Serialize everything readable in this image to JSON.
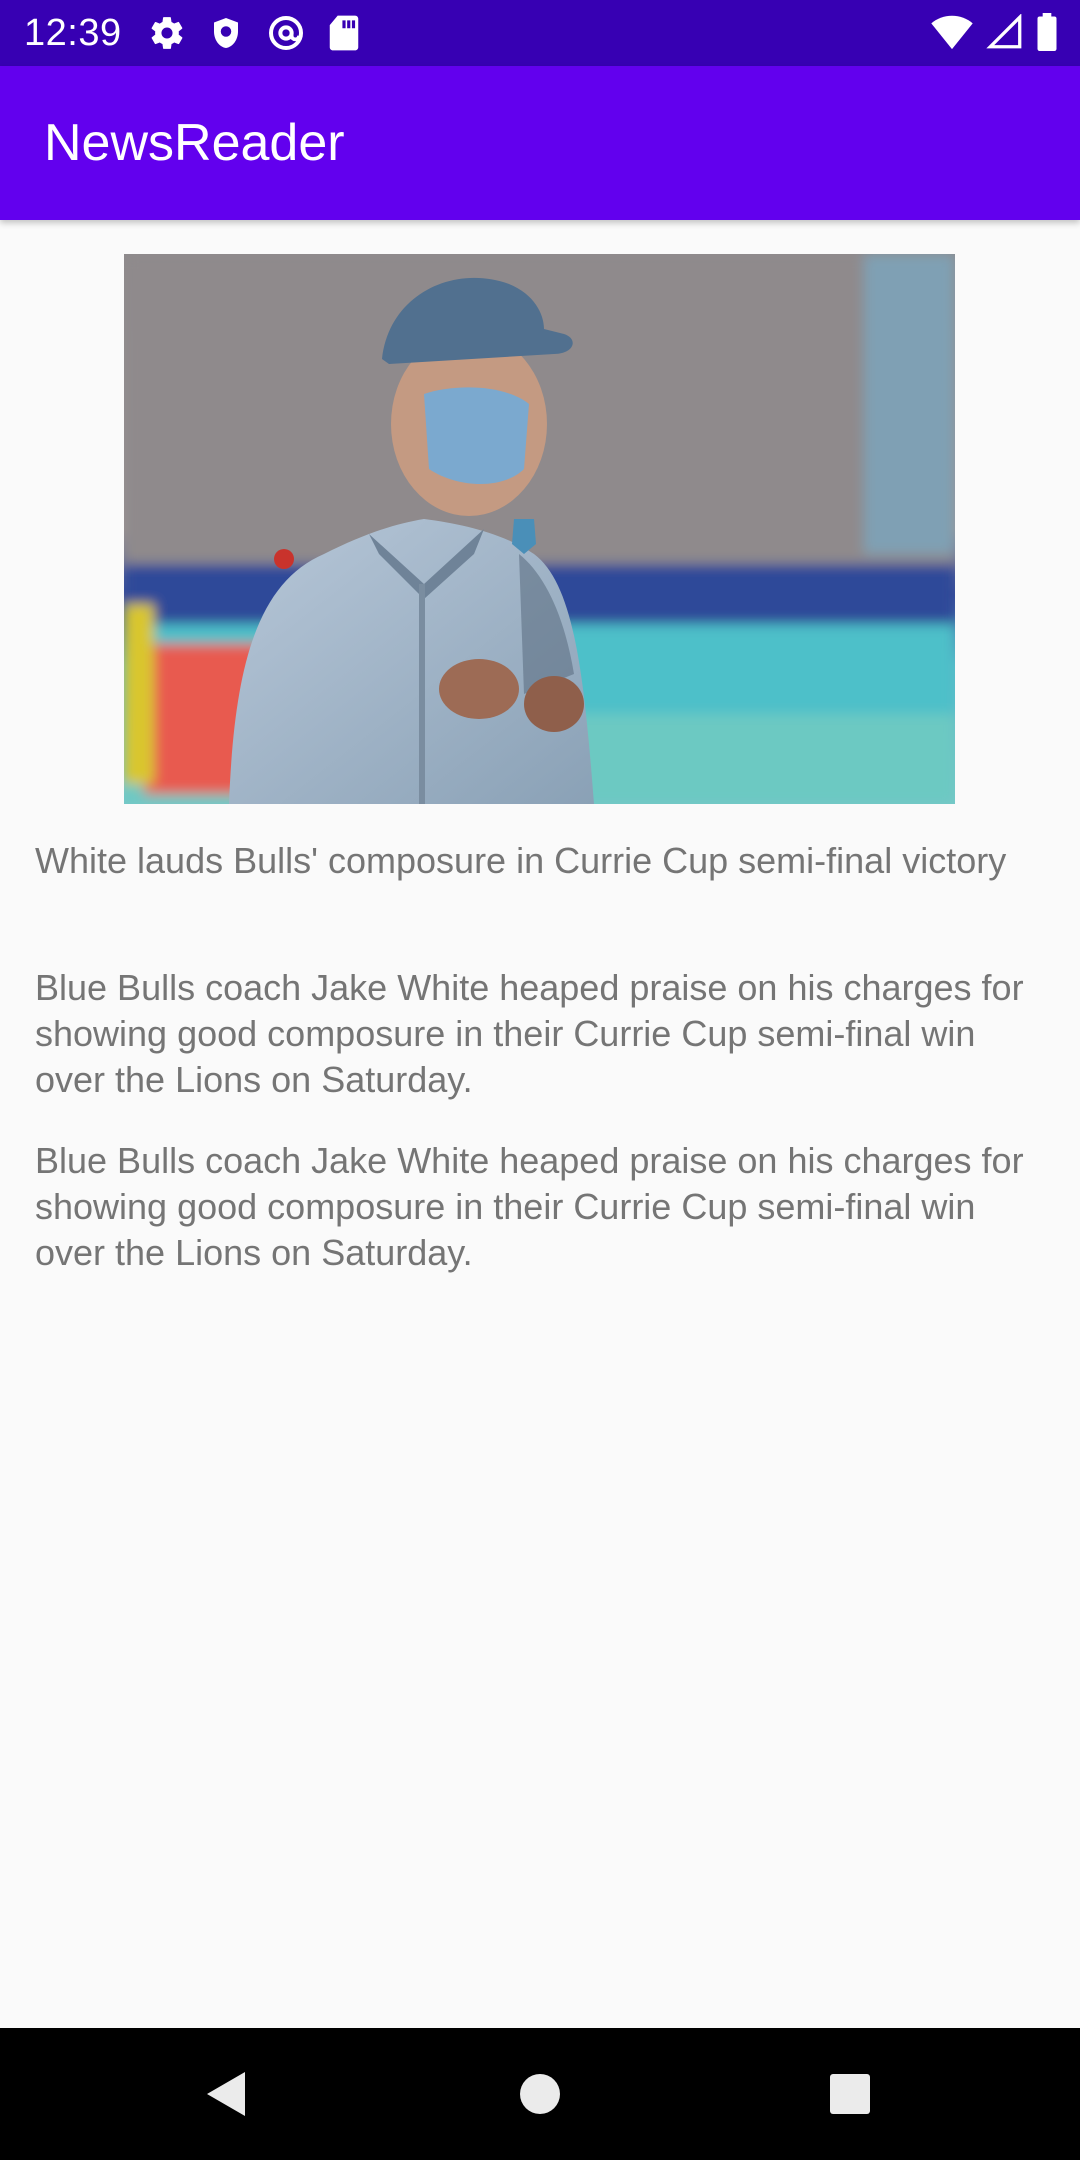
{
  "status_bar": {
    "time": "12:39",
    "left_icons": [
      "settings-icon",
      "shield-icon",
      "at-sign-icon",
      "sd-card-icon"
    ],
    "right_icons": [
      "wifi-icon",
      "cellular-signal-icon",
      "battery-icon"
    ]
  },
  "app_bar": {
    "title": "NewsReader"
  },
  "article": {
    "image_icon": "coach-photo",
    "title": "White lauds Bulls' composure in Currie Cup semi-final victory",
    "description": "Blue Bulls coach Jake White heaped praise on his charges for showing good composure in their Currie Cup semi-final win over the Lions on Saturday.",
    "content": "Blue Bulls coach Jake White heaped praise on his charges for showing good composure in their Currie Cup semi-final win over the Lions on Saturday."
  },
  "nav_bar": {
    "buttons": [
      "back-icon",
      "home-icon",
      "recents-icon"
    ]
  },
  "colors": {
    "status_bar": "#3700b3",
    "app_bar": "#6200ee",
    "background": "#fafafa",
    "body_text": "#757575"
  }
}
